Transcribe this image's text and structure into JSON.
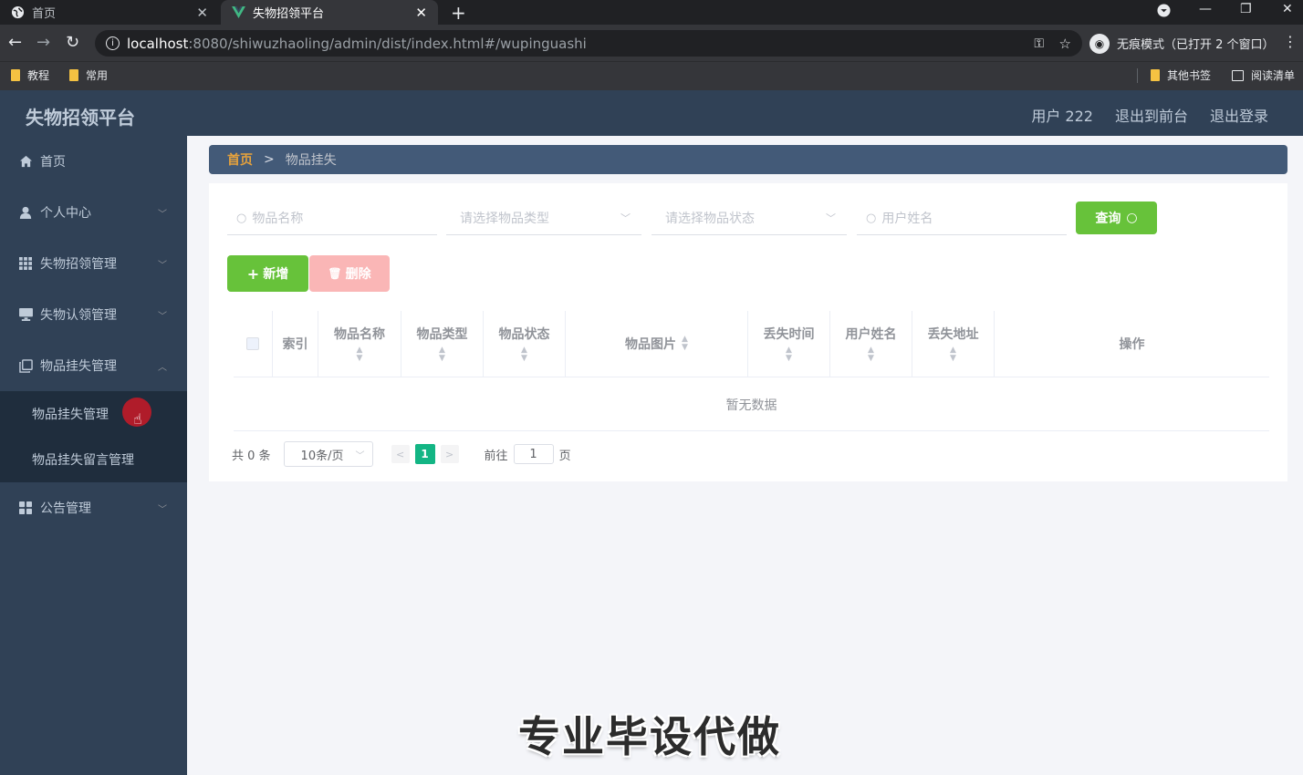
{
  "browser": {
    "tabs": [
      {
        "label": "首页",
        "icon": "globe-icon"
      },
      {
        "label": "失物招领平台",
        "icon": "vue-icon"
      }
    ],
    "url": {
      "host": "localhost",
      "path": ":8080/shiwuzhaoling/admin/dist/index.html#/wupinguashi"
    },
    "incognito_label": "无痕模式（已打开 2 个窗口）",
    "bookmarks": [
      "教程",
      "常用"
    ],
    "bookmarks_right": [
      "其他书签",
      "阅读清单"
    ]
  },
  "header": {
    "brand": "失物招领平台",
    "user": "用户 222",
    "front_link": "退出到前台",
    "logout_link": "退出登录"
  },
  "sidebar": {
    "items": [
      {
        "label": "首页",
        "icon": "home-icon"
      },
      {
        "label": "个人中心",
        "icon": "user-icon"
      },
      {
        "label": "失物招领管理",
        "icon": "grid-icon"
      },
      {
        "label": "失物认领管理",
        "icon": "monitor-icon"
      },
      {
        "label": "物品挂失管理",
        "icon": "copy-icon"
      },
      {
        "label": "公告管理",
        "icon": "apps-icon"
      }
    ],
    "subitems": [
      "物品挂失管理",
      "物品挂失留言管理"
    ]
  },
  "breadcrumb": {
    "home": "首页",
    "separator": ">",
    "current": "物品挂失"
  },
  "filters": {
    "name_placeholder": "物品名称",
    "type_placeholder": "请选择物品类型",
    "status_placeholder": "请选择物品状态",
    "user_placeholder": "用户姓名",
    "query_label": "查询"
  },
  "actions": {
    "add_label": "新增",
    "delete_label": "删除"
  },
  "table": {
    "columns": [
      "索引",
      "物品名称",
      "物品类型",
      "物品状态",
      "物品图片",
      "丢失时间",
      "用户姓名",
      "丢失地址",
      "操作"
    ],
    "empty_text": "暂无数据"
  },
  "pagination": {
    "total": "共 0 条",
    "page_size": "10条/页",
    "current_page": "1",
    "goto_prefix": "前往",
    "goto_value": "1",
    "goto_suffix": "页"
  },
  "watermark": "专业毕设代做",
  "colors": {
    "header_bg": "#304156",
    "primary_green": "#67c23a",
    "danger_light": "#fab6b6",
    "page_active": "#13b584",
    "breadcrumb_bg": "#435a78",
    "home_crumb": "#e6a23c"
  }
}
